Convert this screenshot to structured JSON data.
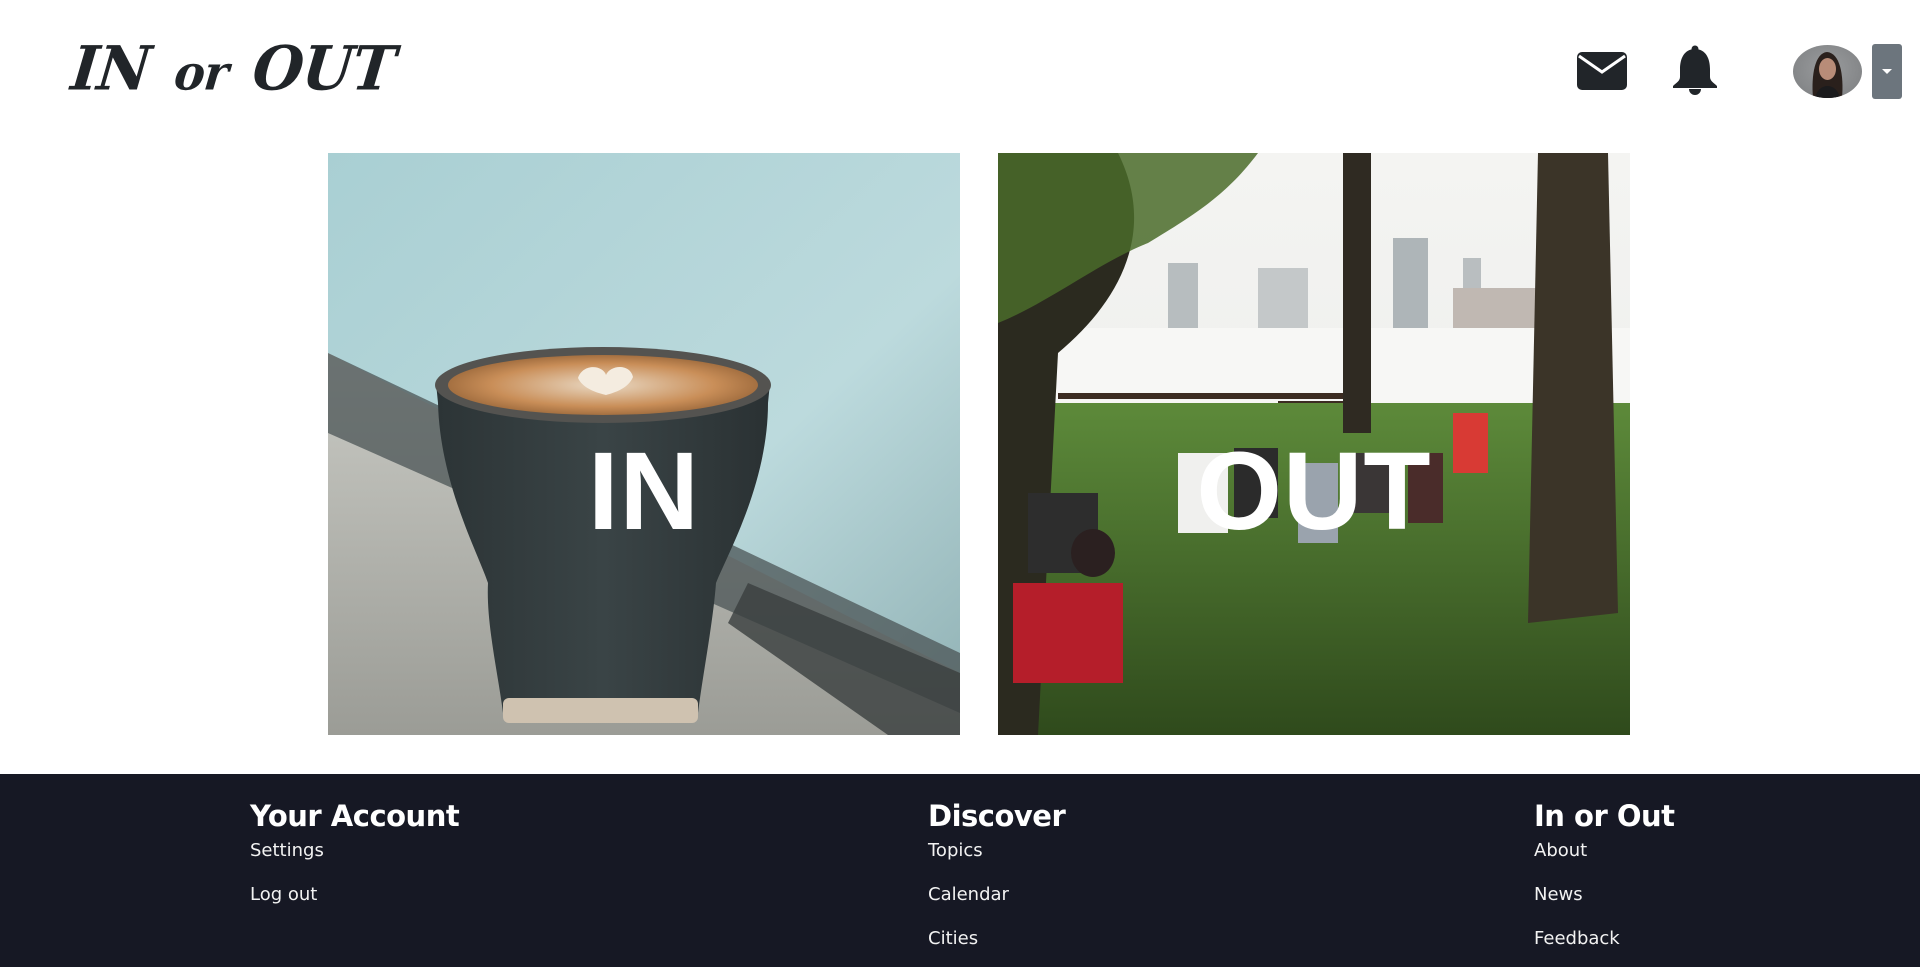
{
  "header": {
    "logo": {
      "part1": "IN",
      "part2": "or",
      "part3": "OUT"
    },
    "icons": {
      "messages": "envelope-icon",
      "notifications": "bell-icon",
      "profile": "user-avatar",
      "menu": "caret-down-icon"
    },
    "colors": {
      "icon": "#212529",
      "dropdown_bg": "#6c757d"
    }
  },
  "tiles": [
    {
      "label": "IN",
      "image": "latte cup by rainy window"
    },
    {
      "label": "OUT",
      "image": "people picnicking in a park by the river"
    }
  ],
  "footer": {
    "background": "#161824",
    "columns": [
      {
        "title": "Your Account",
        "links": [
          "Settings",
          "Log out"
        ]
      },
      {
        "title": "Discover",
        "links": [
          "Topics",
          "Calendar",
          "Cities"
        ]
      },
      {
        "title": "In or Out",
        "links": [
          "About",
          "News",
          "Feedback"
        ]
      }
    ]
  }
}
